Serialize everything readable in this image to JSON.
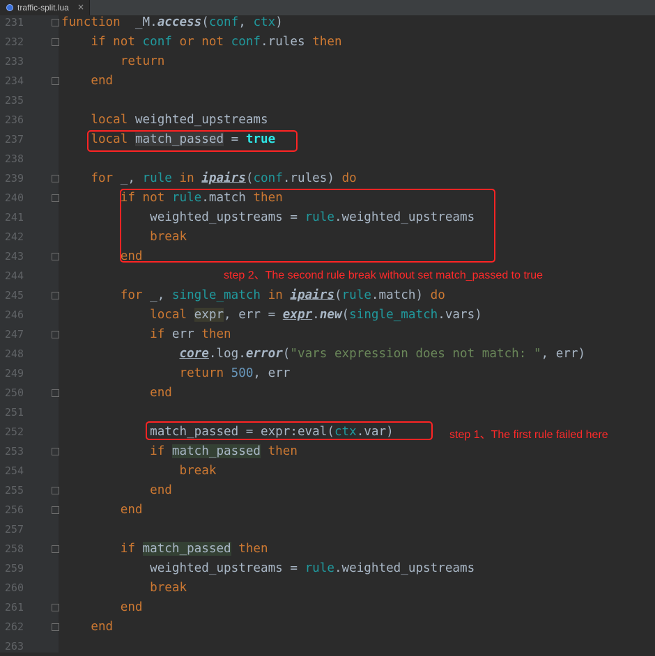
{
  "tab": {
    "filename": "traffic-split.lua",
    "close": "×",
    "icon": "lua-file-icon"
  },
  "lines": [
    {
      "n": "231",
      "segs": [
        [
          "kw",
          "function"
        ],
        [
          "",
          "  _M."
        ],
        [
          "fn",
          "access"
        ],
        [
          "",
          "("
        ],
        [
          "param",
          "conf"
        ],
        [
          "",
          ", "
        ],
        [
          "param",
          "ctx"
        ],
        [
          "",
          ")"
        ]
      ]
    },
    {
      "n": "232",
      "segs": [
        [
          "",
          "    "
        ],
        [
          "kw",
          "if"
        ],
        [
          "",
          " "
        ],
        [
          "kw",
          "not"
        ],
        [
          "",
          " "
        ],
        [
          "param",
          "conf"
        ],
        [
          "",
          " "
        ],
        [
          "kw",
          "or"
        ],
        [
          "",
          " "
        ],
        [
          "kw",
          "not"
        ],
        [
          "",
          " "
        ],
        [
          "param",
          "conf"
        ],
        [
          "",
          ".rules "
        ],
        [
          "kw",
          "then"
        ]
      ]
    },
    {
      "n": "233",
      "segs": [
        [
          "",
          "        "
        ],
        [
          "kw",
          "return"
        ]
      ]
    },
    {
      "n": "234",
      "segs": [
        [
          "",
          "    "
        ],
        [
          "kw",
          "end"
        ]
      ]
    },
    {
      "n": "235",
      "segs": []
    },
    {
      "n": "236",
      "segs": [
        [
          "",
          "    "
        ],
        [
          "kw",
          "local"
        ],
        [
          "",
          " weighted_upstreams"
        ]
      ]
    },
    {
      "n": "237",
      "segs": [
        [
          "",
          "    "
        ],
        [
          "kw",
          "local"
        ],
        [
          "",
          " "
        ],
        [
          "sel",
          "match_passed"
        ],
        [
          "",
          " = "
        ],
        [
          "bool",
          "true"
        ]
      ]
    },
    {
      "n": "238",
      "segs": []
    },
    {
      "n": "239",
      "segs": [
        [
          "",
          "    "
        ],
        [
          "kw",
          "for"
        ],
        [
          "",
          " _, "
        ],
        [
          "param",
          "rule"
        ],
        [
          "",
          " "
        ],
        [
          "kw",
          "in"
        ],
        [
          "",
          " "
        ],
        [
          "gfn",
          "ipairs"
        ],
        [
          "",
          "("
        ],
        [
          "param",
          "conf"
        ],
        [
          "",
          ".rules) "
        ],
        [
          "kw",
          "do"
        ]
      ]
    },
    {
      "n": "240",
      "segs": [
        [
          "",
          "        "
        ],
        [
          "kw",
          "if"
        ],
        [
          "",
          " "
        ],
        [
          "kw",
          "not"
        ],
        [
          "",
          " "
        ],
        [
          "param",
          "rule"
        ],
        [
          "",
          ".match "
        ],
        [
          "kw",
          "then"
        ]
      ]
    },
    {
      "n": "241",
      "segs": [
        [
          "",
          "            weighted_upstreams = "
        ],
        [
          "param",
          "rule"
        ],
        [
          "",
          ".weighted_upstreams"
        ]
      ]
    },
    {
      "n": "242",
      "segs": [
        [
          "",
          "            "
        ],
        [
          "kw",
          "break"
        ]
      ]
    },
    {
      "n": "243",
      "segs": [
        [
          "",
          "        "
        ],
        [
          "kw",
          "end"
        ]
      ]
    },
    {
      "n": "244",
      "segs": []
    },
    {
      "n": "245",
      "segs": [
        [
          "",
          "        "
        ],
        [
          "kw",
          "for"
        ],
        [
          "",
          " _, "
        ],
        [
          "param",
          "single_match"
        ],
        [
          "",
          " "
        ],
        [
          "kw",
          "in"
        ],
        [
          "",
          " "
        ],
        [
          "gfn",
          "ipairs"
        ],
        [
          "",
          "("
        ],
        [
          "param",
          "rule"
        ],
        [
          "",
          ".match) "
        ],
        [
          "kw",
          "do"
        ]
      ]
    },
    {
      "n": "246",
      "segs": [
        [
          "",
          "            "
        ],
        [
          "kw",
          "local"
        ],
        [
          "",
          " "
        ],
        [
          "hl2",
          "expr"
        ],
        [
          "",
          ", err = "
        ],
        [
          "gl",
          "expr"
        ],
        [
          "",
          "."
        ],
        [
          "fn",
          "new"
        ],
        [
          "",
          "("
        ],
        [
          "param",
          "single_match"
        ],
        [
          "",
          ".vars)"
        ]
      ]
    },
    {
      "n": "247",
      "segs": [
        [
          "",
          "            "
        ],
        [
          "kw",
          "if"
        ],
        [
          "",
          " err "
        ],
        [
          "kw",
          "then"
        ]
      ]
    },
    {
      "n": "248",
      "segs": [
        [
          "",
          "                "
        ],
        [
          "gl",
          "core"
        ],
        [
          "",
          ".log."
        ],
        [
          "fn",
          "error"
        ],
        [
          "",
          "("
        ],
        [
          "str",
          "\"vars expression does not match: \""
        ],
        [
          "",
          ", err)"
        ]
      ]
    },
    {
      "n": "249",
      "segs": [
        [
          "",
          "                "
        ],
        [
          "kw",
          "return"
        ],
        [
          "",
          " "
        ],
        [
          "num",
          "500"
        ],
        [
          "",
          ", err"
        ]
      ]
    },
    {
      "n": "250",
      "segs": [
        [
          "",
          "            "
        ],
        [
          "kw",
          "end"
        ]
      ]
    },
    {
      "n": "251",
      "segs": []
    },
    {
      "n": "252",
      "segs": [
        [
          "",
          "            match_passed = expr:"
        ],
        [
          "",
          "eval"
        ],
        [
          "",
          "("
        ],
        [
          "param",
          "ctx"
        ],
        [
          "",
          ".var)"
        ]
      ]
    },
    {
      "n": "253",
      "segs": [
        [
          "",
          "            "
        ],
        [
          "kw",
          "if"
        ],
        [
          "",
          " "
        ],
        [
          "hl",
          "match_passed"
        ],
        [
          "",
          " "
        ],
        [
          "kw",
          "then"
        ]
      ]
    },
    {
      "n": "254",
      "segs": [
        [
          "",
          "                "
        ],
        [
          "kw",
          "break"
        ]
      ]
    },
    {
      "n": "255",
      "segs": [
        [
          "",
          "            "
        ],
        [
          "kw",
          "end"
        ]
      ]
    },
    {
      "n": "256",
      "segs": [
        [
          "",
          "        "
        ],
        [
          "kw",
          "end"
        ]
      ]
    },
    {
      "n": "257",
      "segs": []
    },
    {
      "n": "258",
      "segs": [
        [
          "",
          "        "
        ],
        [
          "kw",
          "if"
        ],
        [
          "",
          " "
        ],
        [
          "hl",
          "match_passed"
        ],
        [
          "",
          " "
        ],
        [
          "kw",
          "then"
        ]
      ]
    },
    {
      "n": "259",
      "segs": [
        [
          "",
          "            weighted_upstreams = "
        ],
        [
          "param",
          "rule"
        ],
        [
          "",
          ".weighted_upstreams"
        ]
      ]
    },
    {
      "n": "260",
      "segs": [
        [
          "",
          "            "
        ],
        [
          "kw",
          "break"
        ]
      ]
    },
    {
      "n": "261",
      "segs": [
        [
          "",
          "        "
        ],
        [
          "kw",
          "end"
        ]
      ]
    },
    {
      "n": "262",
      "segs": [
        [
          "",
          "    "
        ],
        [
          "kw",
          "end"
        ]
      ]
    },
    {
      "n": "263",
      "segs": []
    }
  ],
  "annotations": {
    "step2": "step 2、The second rule break without set match_passed to true",
    "step1": "step 1、The first rule failed here"
  },
  "colors": {
    "annotation": "#ff2424",
    "keyword": "#cc7832",
    "param": "#20999d",
    "string": "#6a8759",
    "number": "#6897bb"
  }
}
